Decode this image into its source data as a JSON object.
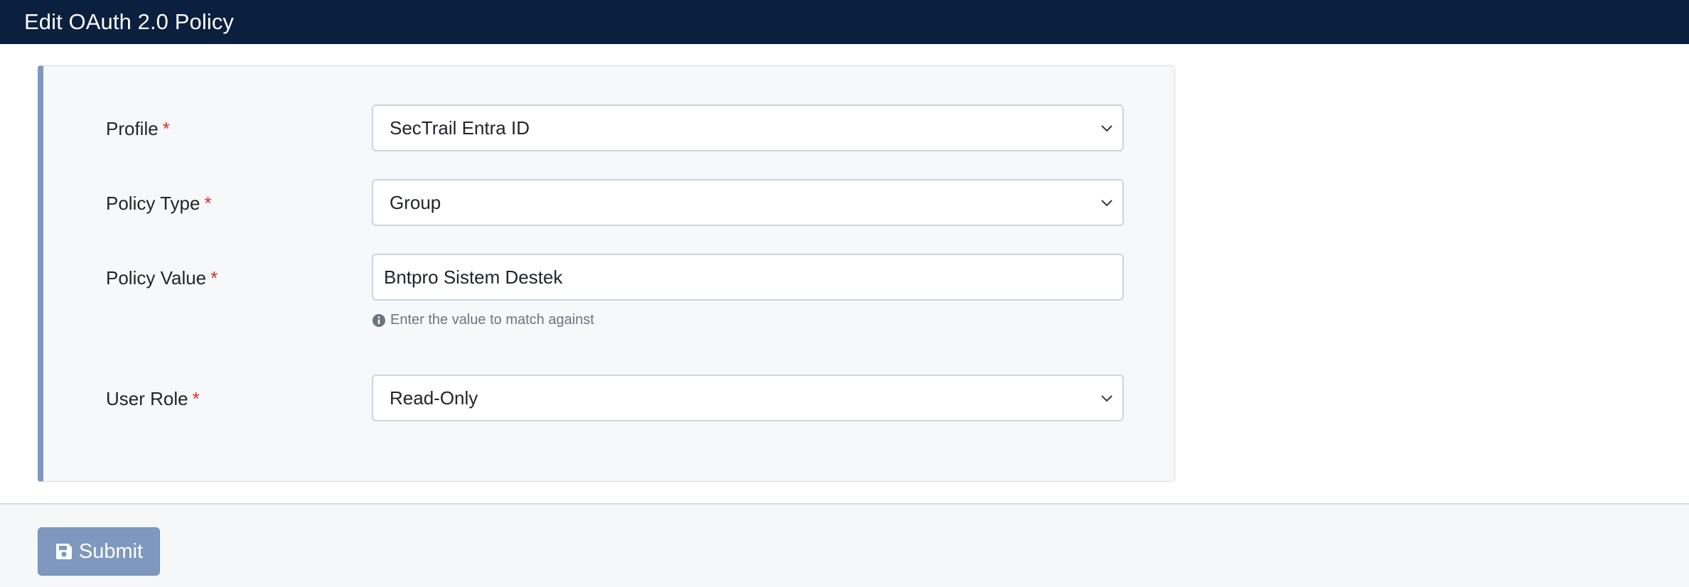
{
  "header": {
    "title": "Edit OAuth 2.0 Policy"
  },
  "form": {
    "required_marker": "*",
    "profile": {
      "label": "Profile",
      "value": "SecTrail Entra ID"
    },
    "policy_type": {
      "label": "Policy Type",
      "value": "Group"
    },
    "policy_value": {
      "label": "Policy Value",
      "value": "Bntpro Sistem Destek",
      "help": "Enter the value to match against"
    },
    "user_role": {
      "label": "User Role",
      "value": "Read-Only"
    }
  },
  "footer": {
    "submit_label": "Submit"
  },
  "icons": {
    "select": "chevron-down-icon",
    "help": "info-circle-icon",
    "submit": "floppy-disk-icon"
  },
  "colors": {
    "header_bg": "#0b1f3f",
    "card_accent": "#7e98bf",
    "button_bg": "#7e98bf",
    "required": "#d93025",
    "help_text": "#6c757d"
  }
}
